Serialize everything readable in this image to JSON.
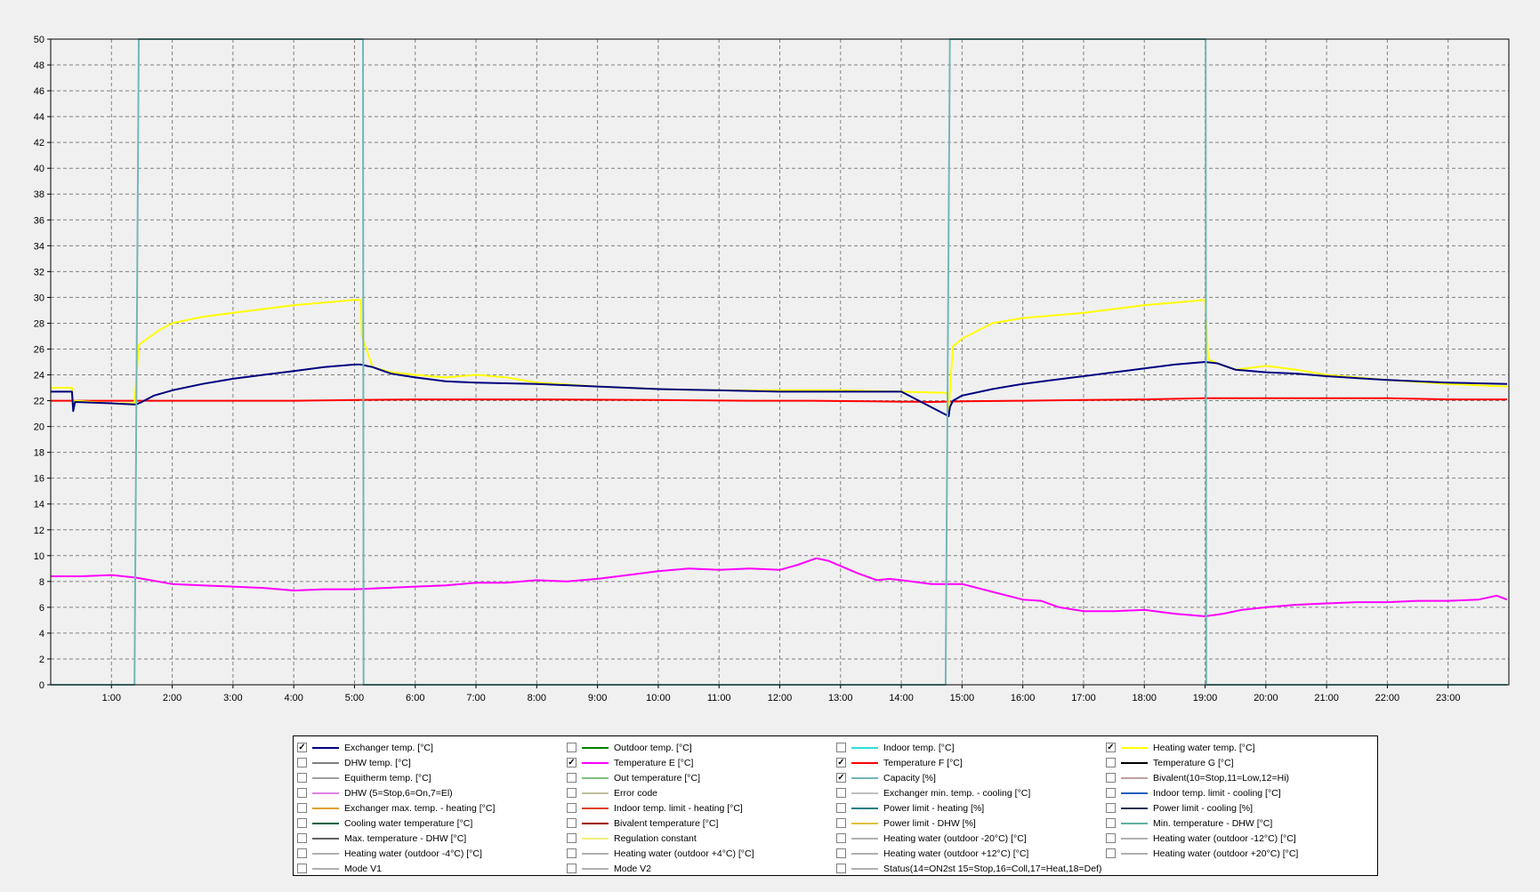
{
  "chart_data": {
    "type": "line",
    "ylim": [
      0,
      50
    ],
    "y_ticks": [
      0,
      2,
      4,
      6,
      8,
      10,
      12,
      14,
      16,
      18,
      20,
      22,
      24,
      26,
      28,
      30,
      32,
      34,
      36,
      38,
      40,
      42,
      44,
      46,
      48,
      50
    ],
    "xlim": [
      0,
      24
    ],
    "x_ticks": [
      {
        "value": 1,
        "label": "1:00"
      },
      {
        "value": 2,
        "label": "2:00"
      },
      {
        "value": 3,
        "label": "3:00"
      },
      {
        "value": 4,
        "label": "4:00"
      },
      {
        "value": 5,
        "label": "5:00"
      },
      {
        "value": 6,
        "label": "6:00"
      },
      {
        "value": 7,
        "label": "7:00"
      },
      {
        "value": 8,
        "label": "8:00"
      },
      {
        "value": 9,
        "label": "9:00"
      },
      {
        "value": 10,
        "label": "10:00"
      },
      {
        "value": 11,
        "label": "11:00"
      },
      {
        "value": 12,
        "label": "12:00"
      },
      {
        "value": 13,
        "label": "13:00"
      },
      {
        "value": 14,
        "label": "14:00"
      },
      {
        "value": 15,
        "label": "15:00"
      },
      {
        "value": 16,
        "label": "16:00"
      },
      {
        "value": 17,
        "label": "17:00"
      },
      {
        "value": 18,
        "label": "18:00"
      },
      {
        "value": 19,
        "label": "19:00"
      },
      {
        "value": 20,
        "label": "20:00"
      },
      {
        "value": 21,
        "label": "21:00"
      },
      {
        "value": 22,
        "label": "22:00"
      },
      {
        "value": 23,
        "label": "23:00"
      }
    ],
    "grid": true,
    "legend_position": "bottom",
    "series": [
      {
        "name": "Exchanger temp. [°C]",
        "color": "#000080",
        "x": [
          0,
          0.35,
          0.37,
          0.4,
          1.0,
          1.4,
          1.5,
          1.7,
          2.0,
          2.5,
          3.0,
          3.5,
          4.0,
          4.5,
          5.0,
          5.1,
          5.3,
          5.6,
          6.0,
          6.5,
          7.0,
          8.0,
          9.0,
          10.0,
          11.0,
          12.0,
          13.0,
          14.0,
          14.78,
          14.8,
          14.85,
          15.0,
          15.5,
          16.0,
          16.5,
          17.0,
          17.5,
          18.0,
          18.5,
          19.0,
          19.2,
          19.5,
          20.0,
          20.5,
          21.0,
          22.0,
          23.0,
          23.97
        ],
        "y": [
          22.7,
          22.7,
          21.2,
          21.9,
          21.8,
          21.7,
          21.9,
          22.4,
          22.8,
          23.3,
          23.7,
          24.0,
          24.3,
          24.6,
          24.8,
          24.8,
          24.6,
          24.1,
          23.8,
          23.5,
          23.4,
          23.3,
          23.1,
          22.9,
          22.8,
          22.7,
          22.7,
          22.7,
          20.8,
          21.5,
          22.0,
          22.4,
          22.9,
          23.3,
          23.6,
          23.9,
          24.2,
          24.5,
          24.8,
          25.0,
          24.9,
          24.4,
          24.2,
          24.1,
          23.9,
          23.6,
          23.4,
          23.3
        ]
      },
      {
        "name": "Heating water temp. [°C]",
        "color": "#ffff00",
        "x": [
          0,
          0.35,
          0.37,
          0.4,
          1.0,
          1.38,
          1.45,
          1.5,
          1.8,
          2.0,
          2.5,
          3.0,
          3.5,
          4.0,
          4.5,
          5.0,
          5.1,
          5.12,
          5.3,
          5.6,
          6.0,
          6.5,
          7.0,
          7.5,
          8.0,
          9.0,
          10.0,
          11.0,
          12.0,
          13.0,
          14.0,
          14.75,
          14.78,
          14.85,
          15.0,
          15.5,
          16.0,
          17.0,
          17.5,
          18.0,
          18.5,
          19.0,
          19.05,
          19.2,
          19.5,
          20.0,
          20.5,
          21.0,
          22.0,
          23.0,
          23.97
        ],
        "y": [
          23.0,
          23.0,
          21.5,
          22.0,
          21.8,
          21.8,
          26.3,
          26.5,
          27.5,
          28.0,
          28.5,
          28.8,
          29.1,
          29.4,
          29.6,
          29.8,
          29.8,
          27.0,
          24.6,
          24.2,
          24.0,
          23.8,
          24.0,
          23.8,
          23.4,
          23.1,
          22.9,
          22.8,
          22.8,
          22.8,
          22.7,
          22.6,
          21.3,
          26.2,
          26.8,
          28.0,
          28.4,
          28.8,
          29.1,
          29.4,
          29.6,
          29.8,
          25.2,
          24.9,
          24.4,
          24.7,
          24.4,
          24.0,
          23.6,
          23.3,
          23.1
        ]
      },
      {
        "name": "Temperature F [°C]",
        "color": "#ff0000",
        "x": [
          0,
          2,
          4,
          5,
          6,
          8,
          10,
          11.5,
          12.5,
          13.5,
          14.5,
          15,
          16,
          17,
          18,
          19,
          20,
          21,
          22,
          23,
          23.97
        ],
        "y": [
          22.0,
          22.0,
          22.0,
          22.05,
          22.1,
          22.1,
          22.05,
          22.0,
          22.0,
          21.95,
          21.9,
          21.95,
          22.0,
          22.05,
          22.1,
          22.2,
          22.2,
          22.2,
          22.2,
          22.1,
          22.1
        ]
      },
      {
        "name": "Temperature E [°C]",
        "color": "#ff00ff",
        "x": [
          0,
          0.5,
          1.0,
          1.4,
          2.0,
          2.5,
          3.0,
          3.5,
          4.0,
          4.5,
          5.0,
          5.5,
          6.0,
          6.5,
          7.0,
          7.5,
          8.0,
          8.5,
          9.0,
          9.5,
          10.0,
          10.5,
          11.0,
          11.5,
          12.0,
          12.3,
          12.6,
          12.8,
          13.0,
          13.3,
          13.6,
          13.8,
          14.0,
          14.5,
          15.0,
          15.5,
          16.0,
          16.3,
          16.6,
          17.0,
          17.5,
          18.0,
          18.5,
          19.0,
          19.3,
          19.6,
          20.0,
          20.5,
          21.0,
          21.5,
          22.0,
          22.5,
          23.0,
          23.5,
          23.8,
          23.97
        ],
        "y": [
          8.4,
          8.4,
          8.5,
          8.3,
          7.8,
          7.7,
          7.6,
          7.5,
          7.3,
          7.4,
          7.4,
          7.5,
          7.6,
          7.7,
          7.9,
          7.9,
          8.1,
          8.0,
          8.2,
          8.5,
          8.8,
          9.0,
          8.9,
          9.0,
          8.9,
          9.3,
          9.8,
          9.6,
          9.2,
          8.6,
          8.1,
          8.2,
          8.1,
          7.8,
          7.8,
          7.2,
          6.6,
          6.5,
          6.0,
          5.7,
          5.7,
          5.8,
          5.5,
          5.3,
          5.5,
          5.8,
          6.0,
          6.2,
          6.3,
          6.4,
          6.4,
          6.5,
          6.5,
          6.6,
          6.9,
          6.6
        ]
      },
      {
        "name": "Capacity [%]",
        "color": "#74b6b8",
        "x": [
          0,
          1.37,
          1.38,
          1.45,
          1.5,
          5.13,
          5.14,
          5.15,
          14.72,
          14.73,
          14.8,
          14.85,
          19.0,
          19.01,
          19.02,
          23.97
        ],
        "y": [
          0,
          0,
          0,
          50,
          50,
          50,
          50,
          0,
          0,
          0,
          50,
          50,
          50,
          50,
          0,
          0
        ]
      }
    ]
  },
  "legend": [
    {
      "label": "Exchanger temp. [°C]",
      "checked": true,
      "color": "#000080"
    },
    {
      "label": "Outdoor temp. [°C]",
      "checked": false,
      "color": "#008000"
    },
    {
      "label": "Indoor temp. [°C]",
      "checked": false,
      "color": "#33dddd"
    },
    {
      "label": "Heating water temp. [°C]",
      "checked": true,
      "color": "#ffff00"
    },
    {
      "label": "DHW temp. [°C]",
      "checked": false,
      "color": "#808080"
    },
    {
      "label": "Temperature E [°C]",
      "checked": true,
      "color": "#ff00ff"
    },
    {
      "label": "Temperature F [°C]",
      "checked": true,
      "color": "#ff0000"
    },
    {
      "label": "Temperature G [°C]",
      "checked": false,
      "color": "#000000"
    },
    {
      "label": "Equitherm temp. [°C]",
      "checked": false,
      "color": "#a0a0a0"
    },
    {
      "label": "Out temperature [°C]",
      "checked": false,
      "color": "#80c080"
    },
    {
      "label": "Capacity [%]",
      "checked": true,
      "color": "#74b6b8"
    },
    {
      "label": "Bivalent(10=Stop,11=Low,12=Hi)",
      "checked": false,
      "color": "#c0a0a0"
    },
    {
      "label": "DHW (5=Stop,6=On,7=El)",
      "checked": false,
      "color": "#e080e0"
    },
    {
      "label": "Error code",
      "checked": false,
      "color": "#c0c0a0"
    },
    {
      "label": "Exchanger min. temp. - cooling [°C]",
      "checked": false,
      "color": "#c0c0c0"
    },
    {
      "label": "Indoor temp. limit - cooling [°C]",
      "checked": false,
      "color": "#2060c0"
    },
    {
      "label": "Exchanger max. temp. - heating [°C]",
      "checked": false,
      "color": "#e0a030"
    },
    {
      "label": "Indoor temp. limit - heating [°C]",
      "checked": false,
      "color": "#e04020"
    },
    {
      "label": "Power limit - heating [%]",
      "checked": false,
      "color": "#208080"
    },
    {
      "label": "Power limit - cooling [%]",
      "checked": false,
      "color": "#203050"
    },
    {
      "label": "Cooling water temperature [°C]",
      "checked": false,
      "color": "#006040"
    },
    {
      "label": "Bivalent temperature [°C]",
      "checked": false,
      "color": "#a00000"
    },
    {
      "label": "Power limit - DHW [%]",
      "checked": false,
      "color": "#e0c040"
    },
    {
      "label": "Min. temperature - DHW [°C]",
      "checked": false,
      "color": "#60b0a0"
    },
    {
      "label": "Max. temperature - DHW [°C]",
      "checked": false,
      "color": "#606060"
    },
    {
      "label": "Regulation constant",
      "checked": false,
      "color": "#f0f080"
    },
    {
      "label": "Heating water (outdoor -20°C) [°C]",
      "checked": false,
      "color": "#b0b0b0"
    },
    {
      "label": "Heating water (outdoor -12°C) [°C]",
      "checked": false,
      "color": "#b0b0b0"
    },
    {
      "label": "Heating water (outdoor -4°C) [°C]",
      "checked": false,
      "color": "#b0b0b0"
    },
    {
      "label": "Heating water (outdoor +4°C) [°C]",
      "checked": false,
      "color": "#b0b0b0"
    },
    {
      "label": "Heating water (outdoor +12°C) [°C]",
      "checked": false,
      "color": "#b0b0b0"
    },
    {
      "label": "Heating water (outdoor +20°C) [°C]",
      "checked": false,
      "color": "#b0b0b0"
    },
    {
      "label": "Mode V1",
      "checked": false,
      "color": "#b0b0b0"
    },
    {
      "label": "Mode V2",
      "checked": false,
      "color": "#b0b0b0"
    },
    {
      "label": "Status(14=ON2st 15=Stop,16=Coll,17=Heat,18=Def)",
      "checked": false,
      "color": "#b0b0b0"
    }
  ]
}
